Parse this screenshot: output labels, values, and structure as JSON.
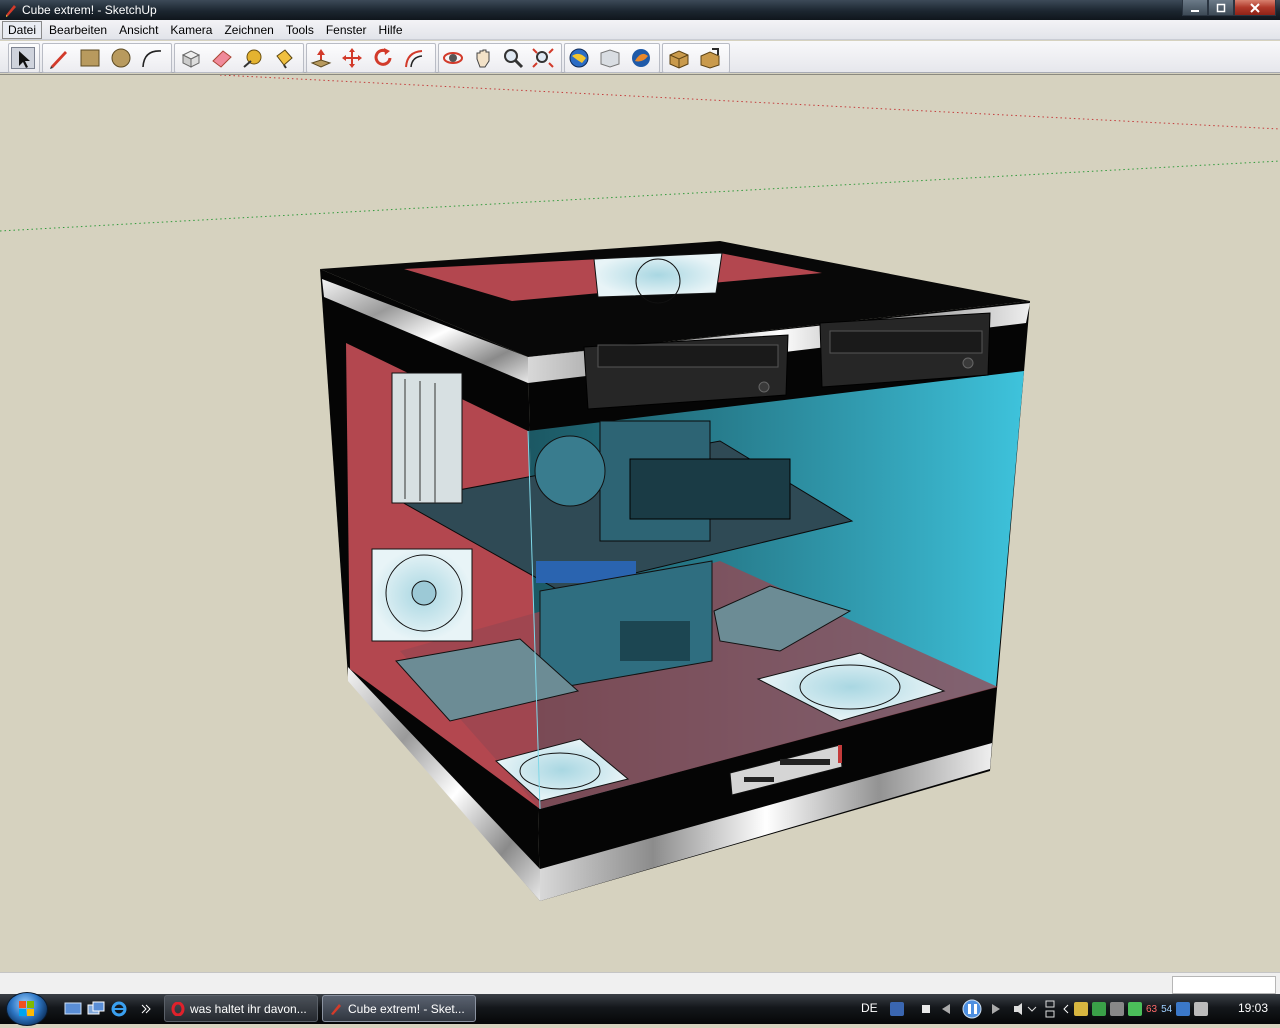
{
  "window": {
    "title": "Cube extrem! - SketchUp",
    "controls": [
      "minimize",
      "maximize",
      "close"
    ]
  },
  "menu": {
    "items": [
      {
        "label": "Datei",
        "active": true
      },
      {
        "label": "Bearbeiten"
      },
      {
        "label": "Ansicht"
      },
      {
        "label": "Kamera"
      },
      {
        "label": "Zeichnen"
      },
      {
        "label": "Tools"
      },
      {
        "label": "Fenster"
      },
      {
        "label": "Hilfe"
      }
    ]
  },
  "toolbar": {
    "tools": [
      "select-icon",
      "pencil-icon",
      "rectangle-icon",
      "circle-icon",
      "arc-icon",
      "make-component-icon",
      "eraser-icon",
      "tape-measure-icon",
      "paint-bucket-icon",
      "push-pull-icon",
      "move-icon",
      "rotate-icon",
      "offset-icon",
      "orbit-icon",
      "pan-icon",
      "zoom-icon",
      "zoom-extents-icon",
      "get-models-icon",
      "share-model-icon",
      "google-earth-icon",
      "component-icon",
      "share-component-icon"
    ]
  },
  "taskbar": {
    "tasks": [
      {
        "label": "was haltet ihr davon...",
        "icon": "opera-icon"
      },
      {
        "label": "Cube extrem! - Sket...",
        "icon": "sketchup-icon",
        "active": true
      }
    ],
    "language": "DE",
    "tray_numbers": [
      "63",
      "54"
    ],
    "clock": "19:03"
  },
  "colors": {
    "viewport_bg": "#d6d2bf",
    "case_frame": "#050505",
    "chrome_trim": "#c9c9c9",
    "glass_tint": "#3ec3dc",
    "interior_red": "#b3474f"
  }
}
